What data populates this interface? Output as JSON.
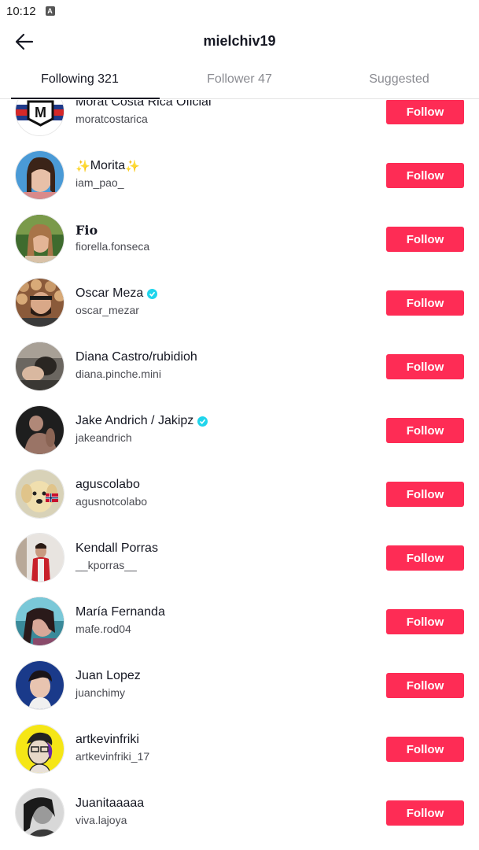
{
  "status_bar": {
    "time": "10:12"
  },
  "header": {
    "title": "mielchiv19"
  },
  "tabs": [
    {
      "label": "Following 321",
      "active": true
    },
    {
      "label": "Follower 47",
      "active": false
    },
    {
      "label": "Suggested",
      "active": false
    }
  ],
  "colors": {
    "follow_button": "#fe2c55",
    "verified": "#20d5ec",
    "sparkle": "#f5c518"
  },
  "follow_label": "Follow",
  "users": [
    {
      "name": "Morat Costa Rica Oficial",
      "handle": "moratcostarica",
      "verified": false
    },
    {
      "name": "Morita",
      "handle": "iam_pao_",
      "verified": false,
      "sparkles": "✨"
    },
    {
      "name": "Fio",
      "handle": "fiorella.fonseca",
      "verified": false
    },
    {
      "name": "Oscar Meza",
      "handle": "oscar_mezar",
      "verified": true
    },
    {
      "name": "Diana Castro/rubidioh",
      "handle": "diana.pinche.mini",
      "verified": false
    },
    {
      "name": "Jake Andrich / Jakipz",
      "handle": "jakeandrich",
      "verified": true
    },
    {
      "name": "aguscolabo",
      "handle": "agusnotcolabo",
      "verified": false
    },
    {
      "name": "Kendall Porras",
      "handle": "__kporras__",
      "verified": false
    },
    {
      "name": "María Fernanda",
      "handle": "mafe.rod04",
      "verified": false
    },
    {
      "name": "Juan Lopez",
      "handle": "juanchimy",
      "verified": false
    },
    {
      "name": "artkevinfriki",
      "handle": "artkevinfriki_17",
      "verified": false
    },
    {
      "name": "Juanitaaaaa",
      "handle": "viva.lajoya",
      "verified": false
    }
  ]
}
